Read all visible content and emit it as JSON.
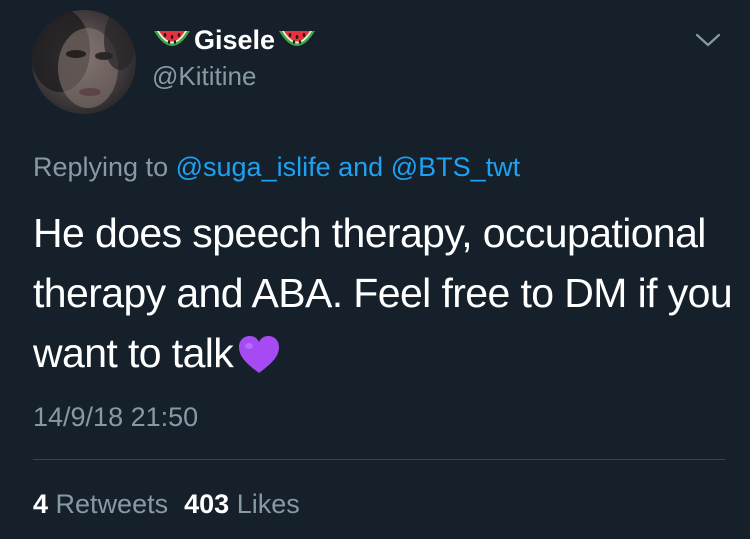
{
  "author": {
    "display_name": "Gisele",
    "handle": "@Kititine",
    "name_emoji": "watermelon-icon"
  },
  "reply": {
    "prefix": "Replying to",
    "mention_1": "@suga_islife",
    "joiner": "and",
    "mention_2": "@BTS_twt"
  },
  "tweet": {
    "text": "He does speech therapy, occupational therapy and ABA. Feel free to DM if you want to talk",
    "emoji": "purple-heart-icon",
    "timestamp": "14/9/18 21:50"
  },
  "stats": {
    "retweets_count": "4",
    "retweets_label": "Retweets",
    "likes_count": "403",
    "likes_label": "Likes"
  },
  "colors": {
    "background": "#15202b",
    "secondary_text": "#8899a6",
    "link": "#1da1f2",
    "divider": "#38444d"
  }
}
